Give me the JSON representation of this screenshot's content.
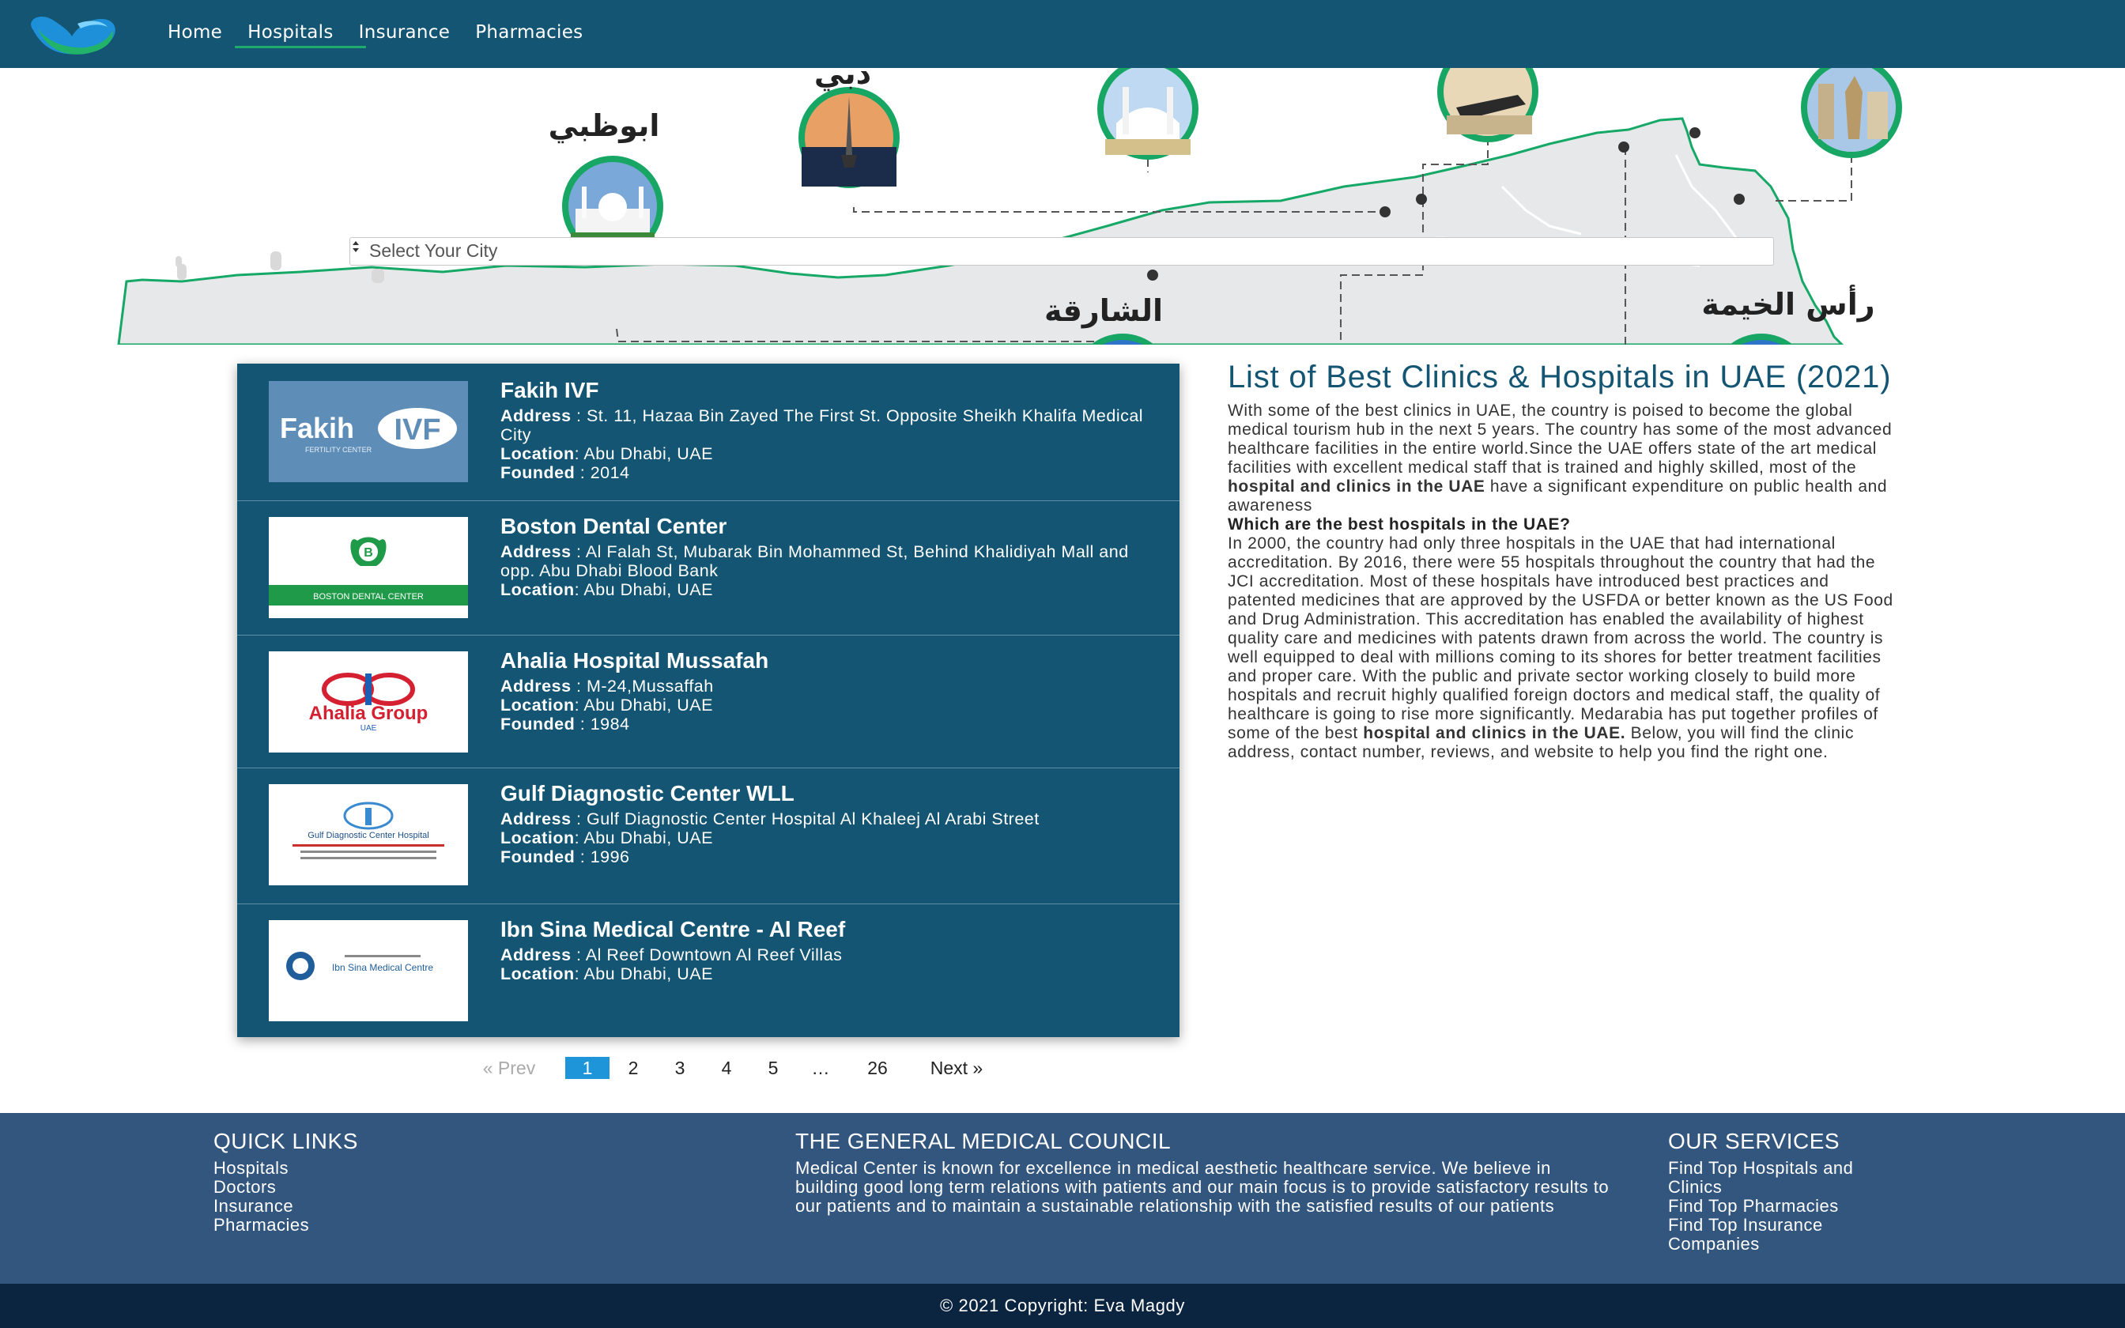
{
  "nav": {
    "items": [
      {
        "label": "Home"
      },
      {
        "label": "Hospitals"
      },
      {
        "label": "Insurance"
      },
      {
        "label": "Pharmacies"
      }
    ],
    "active": "Hospitals"
  },
  "hero": {
    "cities": {
      "dubai": "دبي",
      "abu_dhabi": "ابوظبي",
      "sharjah": "الشارقة",
      "ras_al_khaimah": "رأس الخيمة"
    },
    "select": {
      "value": "Select Your City"
    }
  },
  "listings": [
    {
      "name": "Fakih IVF",
      "logo_text": "Fakih",
      "logo_badge": "IVF",
      "logo_sub": "FERTILITY CENTER",
      "fields": [
        {
          "label": "Address",
          "sep": " : ",
          "value": "St. 11, Hazaa Bin Zayed The First St. Opposite Sheikh Khalifa Medical City"
        },
        {
          "label": "Location",
          "sep": ": ",
          "value": "Abu Dhabi, UAE"
        },
        {
          "label": "Founded",
          "sep": " : ",
          "value": "2014"
        }
      ]
    },
    {
      "name": "Boston Dental Center",
      "logo_text": "BOSTON DENTAL CENTER",
      "logo_badge": "B",
      "fields": [
        {
          "label": "Address",
          "sep": " : ",
          "value": "Al Falah St, Mubarak Bin Mohammed St, Behind Khalidiyah Mall and opp. Abu Dhabi Blood Bank"
        },
        {
          "label": "Location",
          "sep": ": ",
          "value": "Abu Dhabi, UAE"
        }
      ]
    },
    {
      "name": "Ahalia Hospital Mussafah",
      "logo_text": "Ahalia Group",
      "logo_sub": "UAE",
      "fields": [
        {
          "label": "Address",
          "sep": " : ",
          "value": "M-24,Mussaffah"
        },
        {
          "label": "Location",
          "sep": ": ",
          "value": "Abu Dhabi, UAE"
        },
        {
          "label": "Founded",
          "sep": " : ",
          "value": "1984"
        }
      ]
    },
    {
      "name": "Gulf Diagnostic Center WLL",
      "logo_text": "Gulf Diagnostic Center Hospital",
      "fields": [
        {
          "label": "Address",
          "sep": " : ",
          "value": "Gulf Diagnostic Center Hospital Al Khaleej Al Arabi Street"
        },
        {
          "label": "Location",
          "sep": ": ",
          "value": "Abu Dhabi, UAE"
        },
        {
          "label": "Founded",
          "sep": " : ",
          "value": "1996"
        }
      ]
    },
    {
      "name": "Ibn Sina Medical Centre - Al Reef",
      "logo_text": "Ibn Sina Medical Centre",
      "fields": [
        {
          "label": "Address",
          "sep": " : ",
          "value": "Al Reef Downtown Al Reef Villas"
        },
        {
          "label": "Location",
          "sep": ": ",
          "value": "Abu Dhabi, UAE"
        }
      ]
    }
  ],
  "pagination": {
    "prev": "« Prev",
    "pages": [
      "1",
      "2",
      "3",
      "4",
      "5",
      "…",
      "26"
    ],
    "current": "1",
    "next": "Next »"
  },
  "article": {
    "title": "List of Best Clinics & Hospitals in UAE (2021)",
    "p1_start": "With some of the best clinics in UAE, the country is poised to become the global medical tourism hub in the next 5 years. The country has some of the most advanced healthcare facilities in the entire world.Since the UAE offers state of the art medical facilities with excellent medical staff that is trained and highly skilled, most of the ",
    "p1_bold": "hospital and clinics in the UAE",
    "p1_end": " have a significant expenditure on public health and awareness",
    "question": "Which are the best hospitals in the UAE?",
    "p2_start": "In 2000, the country had only three hospitals in the UAE that had international accreditation. By 2016, there were 55 hospitals throughout the country that had the JCI accreditation. Most of these hospitals have introduced best practices and patented medicines that are approved by the USFDA or better known as the US Food and Drug Administration. This accreditation has enabled the availability of highest quality care and medicines with patents drawn from across the world. The country is well equipped to deal with millions coming to its shores for better treatment facilities and proper care. With the public and private sector working closely to build more hospitals and recruit highly qualified foreign doctors and medical staff, the quality of healthcare is going to rise more significantly. Medarabia has put together profiles of some of the best ",
    "p2_bold": "hospital and clinics in the UAE.",
    "p2_end": " Below, you will find the clinic address, contact number, reviews, and website to help you find the right one."
  },
  "footer": {
    "quick_links": {
      "title": "QUICK LINKS",
      "items": [
        "Hospitals",
        "Doctors",
        "Insurance",
        "Pharmacies"
      ]
    },
    "council": {
      "title": "THE GENERAL MEDICAL COUNCIL",
      "text": "Medical Center is known for excellence in medical aesthetic healthcare service. We believe in building good long term relations with patients and our main focus is to provide satisfactory results to our patients and to maintain a sustainable relationship with the satisfied results of our patients"
    },
    "services": {
      "title": "OUR SERVICES",
      "items": [
        "Find Top Hospitals and Clinics",
        "Find Top Pharmacies",
        "Find Top Insurance Companies"
      ]
    },
    "copyright": "© 2021 Copyright: Eva Magdy"
  },
  "colors": {
    "navbar": "#135572",
    "accent_green": "#1faa6e",
    "panel": "#135572",
    "footer": "#33567f",
    "copyright_bg": "#0b2440",
    "pager_active": "#1e95d9"
  }
}
